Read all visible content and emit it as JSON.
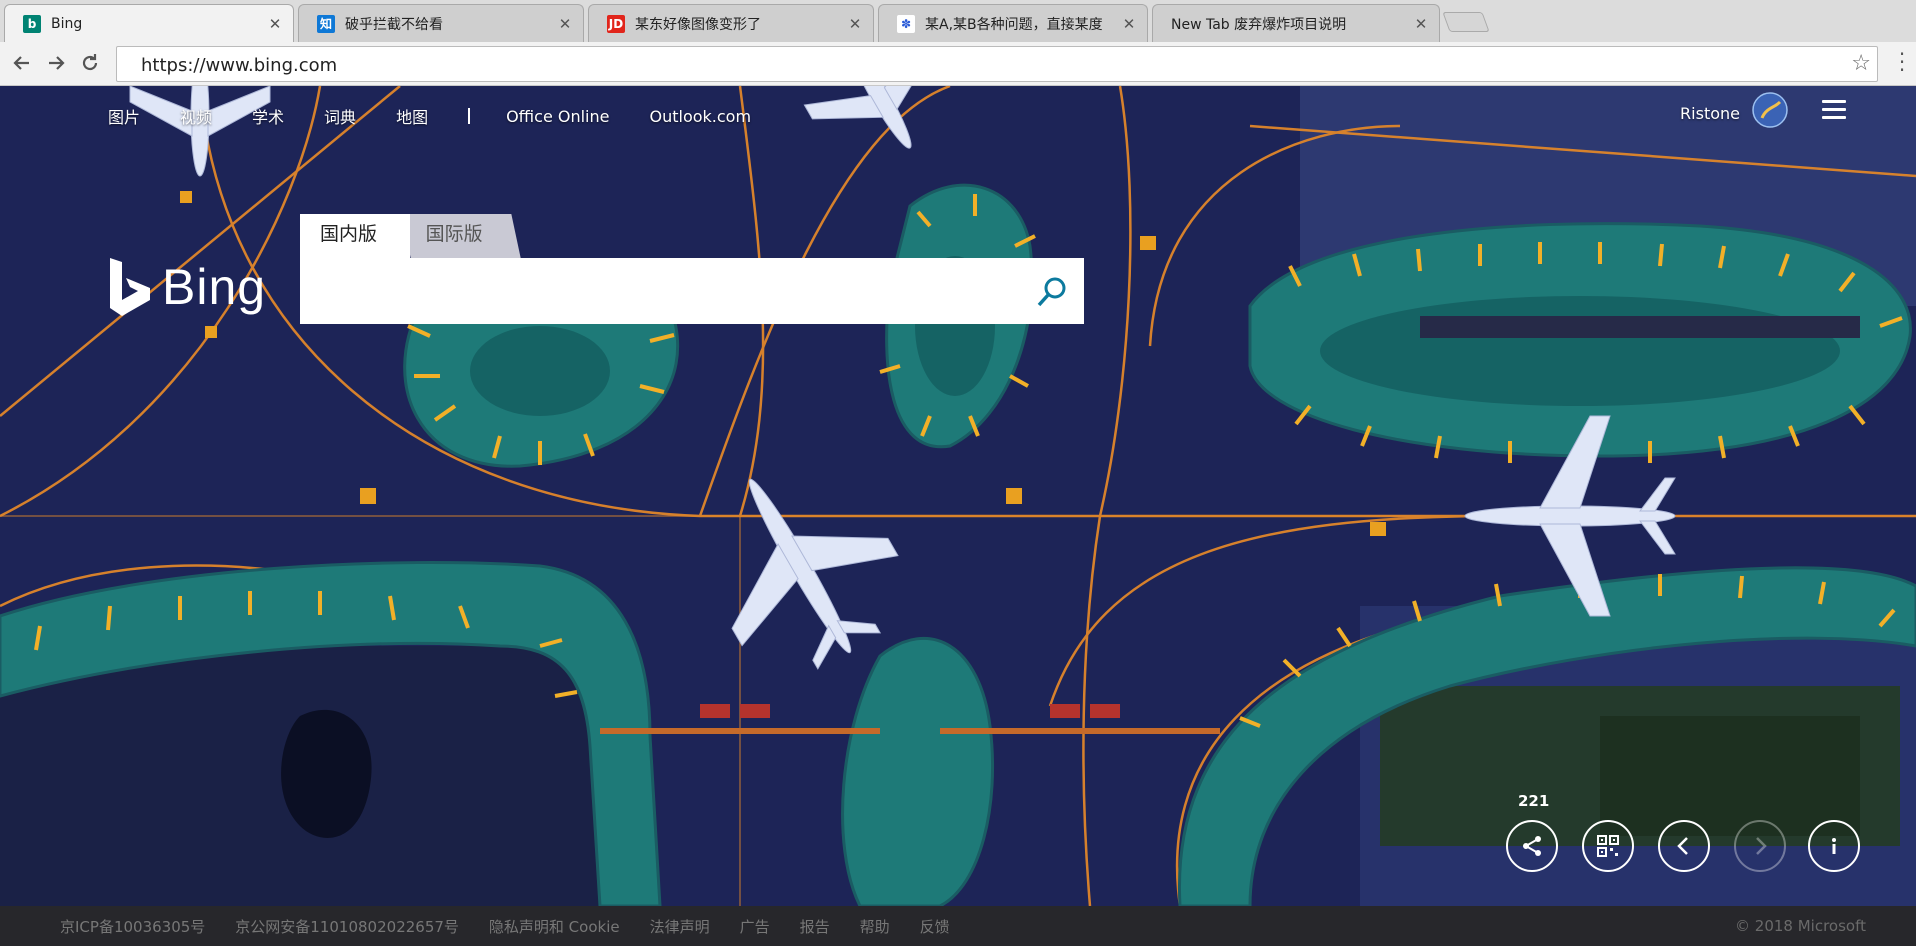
{
  "browser": {
    "tabs": [
      {
        "title": "Bing",
        "favicon": "bing-logo",
        "color": "#008373"
      },
      {
        "title": "破乎拦截不给看",
        "favicon": "zhihu-logo",
        "color": "#0e78d6"
      },
      {
        "title": "某东好像图像变形了",
        "favicon": "jd-logo",
        "color": "#e1251b"
      },
      {
        "title": "某A,某B各种问题，直接某度",
        "favicon": "baidu-paw",
        "color": "#2a5bd7"
      },
      {
        "title": "New Tab 废弃爆炸项目说明",
        "favicon": "",
        "color": ""
      }
    ],
    "url": "https://www.bing.com",
    "nav_icons": [
      "back-arrow-icon",
      "forward-arrow-icon",
      "reload-icon",
      "star-icon",
      "more-menu-icon"
    ]
  },
  "nav": {
    "items": [
      "图片",
      "视频",
      "学术",
      "词典",
      "地图"
    ],
    "links": [
      "Office Online",
      "Outlook.com"
    ]
  },
  "account": {
    "name": "Ristone"
  },
  "logo": {
    "text": "Bing"
  },
  "search": {
    "tab_domestic": "国内版",
    "tab_international": "国际版",
    "query": ""
  },
  "gallery": {
    "share_count": "221",
    "controls": [
      "share-icon",
      "qr-code-icon",
      "previous-icon",
      "next-icon",
      "info-icon"
    ]
  },
  "footer": {
    "links": [
      "京ICP备10036305号",
      "京公网安备11010802022657号",
      "隐私声明和 Cookie",
      "法律声明",
      "广告",
      "报告",
      "帮助",
      "反馈"
    ],
    "copyright": "© 2018 Microsoft"
  },
  "colors": {
    "accent": "#008373",
    "search_icon": "#0c7a9e",
    "apron_green": "#1e7a78",
    "taxiway": "#e0862a"
  }
}
